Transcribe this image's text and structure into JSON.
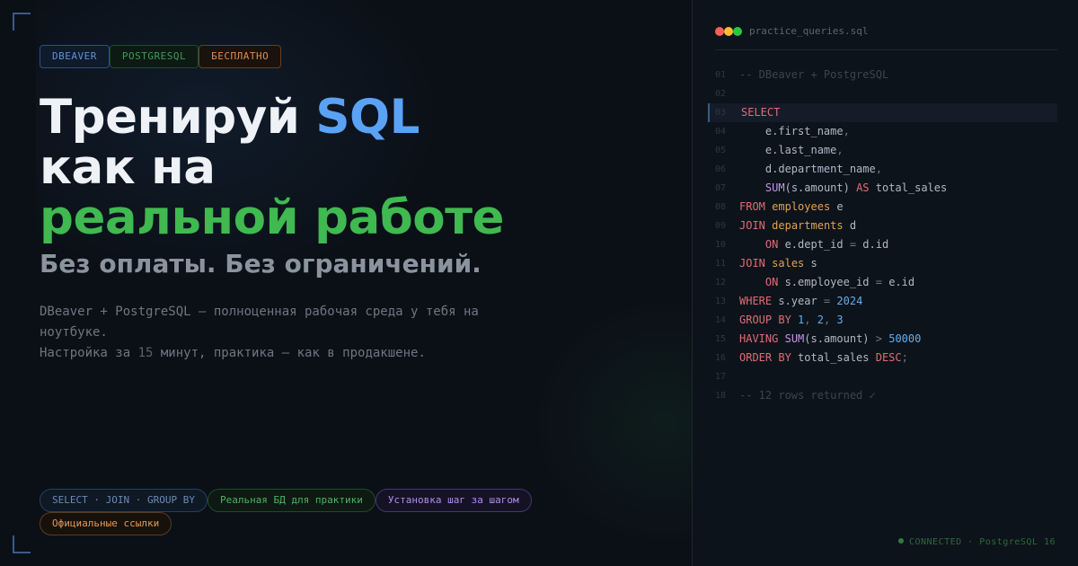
{
  "header": {
    "tags": [
      "DBEAVER",
      "POSTGRESQL",
      "БЕСПЛАТНО"
    ]
  },
  "headline": {
    "line1_part1": "Тренируй ",
    "line1_part2": "SQL",
    "line2": "как на",
    "line3": "реальной работе",
    "subhead": "Без оплаты. Без ограничений."
  },
  "description": {
    "line1": "DBeaver + PostgreSQL — полноценная рабочая среда у тебя на ноутбуке.",
    "line2_a": "Настройка за ",
    "line2_num": "15",
    "line2_b": " минут, практика — как в продакшене."
  },
  "features": [
    "SELECT · JOIN · GROUP BY",
    "Реальная БД для практики",
    "Установка шаг за шагом",
    "Официальные ссылки"
  ],
  "editor": {
    "filename": "practice_queries.sql",
    "line_numbers": [
      "01",
      "02",
      "03",
      "04",
      "05",
      "06",
      "07",
      "08",
      "09",
      "10",
      "11",
      "12",
      "13",
      "14",
      "15",
      "16",
      "17",
      "18"
    ],
    "status_connected": "CONNECTED",
    "status_sep": " · ",
    "status_db": "PostgreSQL 16"
  },
  "colors": {
    "background": "#0b1017",
    "accent_blue": "#5aa2f5",
    "accent_green": "#3fb950",
    "keyword": "#e06c75",
    "table": "#e5a04f",
    "function": "#c792ea"
  }
}
